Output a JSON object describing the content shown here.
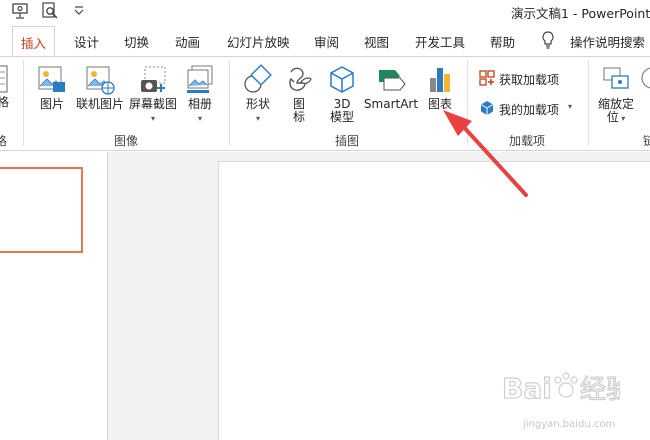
{
  "window": {
    "title": "演示文稿1  -  PowerPoint"
  },
  "tabs": [
    {
      "label": "插入",
      "active": true
    },
    {
      "label": "设计"
    },
    {
      "label": "切换"
    },
    {
      "label": "动画"
    },
    {
      "label": "幻灯片放映"
    },
    {
      "label": "审阅"
    },
    {
      "label": "视图"
    },
    {
      "label": "开发工具"
    },
    {
      "label": "帮助"
    },
    {
      "label": "操作说明搜索"
    }
  ],
  "ribbon": {
    "cut_left_label": "格",
    "cut_left_group": "格",
    "images_group": {
      "label": "图像",
      "picture": "图片",
      "online_picture": "联机图片",
      "screenshot": "屏幕截图",
      "album": "相册"
    },
    "illustrations_group": {
      "label": "插图",
      "shapes": "形状",
      "icons_line1": "图",
      "icons_line2": "标",
      "model3d_line1": "3D",
      "model3d_line2": "模型",
      "smartart": "SmartArt",
      "chart": "图表"
    },
    "addins_group": {
      "label": "加载项",
      "get_addins": "获取加载项",
      "my_addins": "我的加载项"
    },
    "zoom": {
      "line1": "缩放定",
      "line2": "位"
    },
    "cut_right_group": "链"
  },
  "annotation": {
    "arrow_color": "#e8413f",
    "target": "chart-button"
  },
  "watermark": {
    "brand": "Baidu",
    "sub": "jingyan.baidu.com"
  },
  "colors": {
    "active_tab": "#c43e1c",
    "selected_slide_border": "#e97553"
  }
}
